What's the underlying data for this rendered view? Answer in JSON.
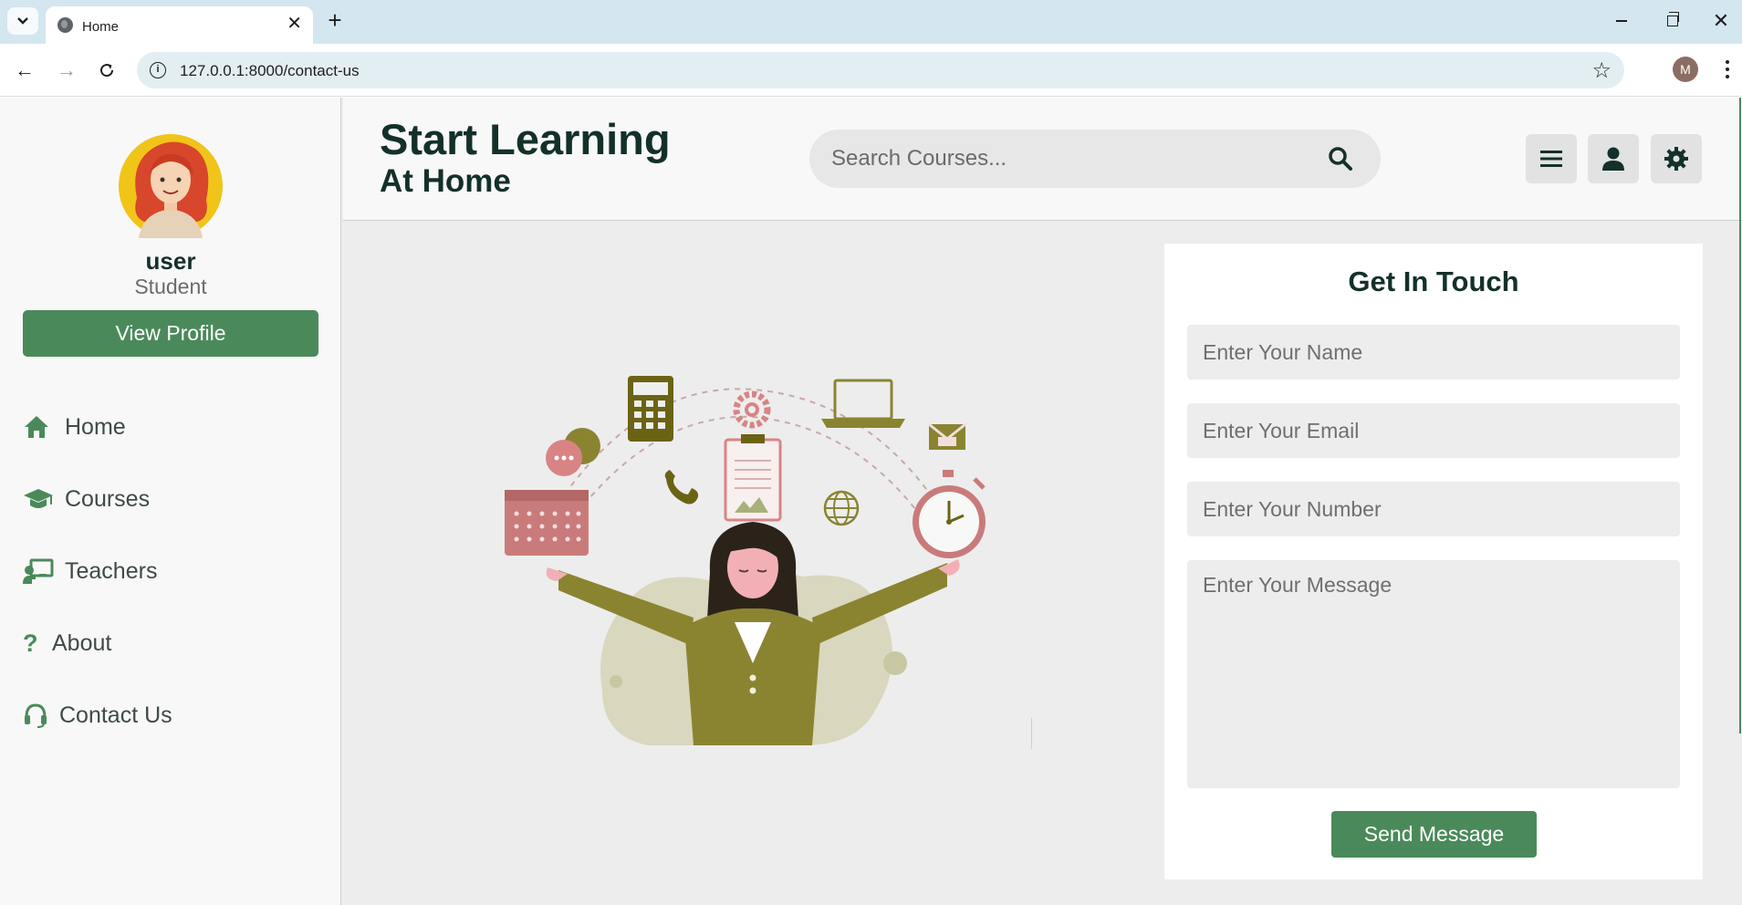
{
  "browser": {
    "tab_title": "Home",
    "url": "127.0.0.1:8000/contact-us",
    "profile_initial": "M"
  },
  "sidebar": {
    "user_name": "user",
    "user_role": "Student",
    "view_profile_label": "View Profile",
    "items": [
      {
        "label": "Home",
        "icon": "home-icon"
      },
      {
        "label": "Courses",
        "icon": "graduation-cap-icon"
      },
      {
        "label": "Teachers",
        "icon": "chalkboard-teacher-icon"
      },
      {
        "label": "About",
        "icon": "question-icon"
      },
      {
        "label": "Contact Us",
        "icon": "headset-icon"
      }
    ]
  },
  "header": {
    "brand_line1": "Start Learning",
    "brand_line2": "At Home",
    "search_placeholder": "Search Courses..."
  },
  "contact": {
    "title": "Get In Touch",
    "name_placeholder": "Enter Your Name",
    "email_placeholder": "Enter Your Email",
    "number_placeholder": "Enter Your Number",
    "message_placeholder": "Enter Your Message",
    "send_label": "Send Message"
  },
  "colors": {
    "brand_green": "#4a8a5a",
    "heading_dark": "#14302a",
    "illustration_olive": "#8a8431",
    "illustration_rose": "#c97b7b"
  }
}
